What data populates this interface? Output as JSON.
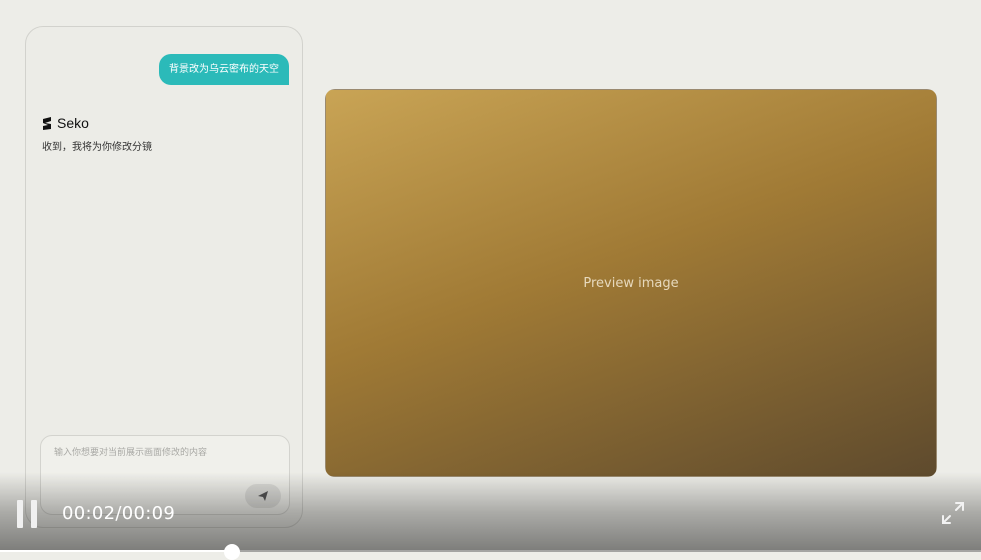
{
  "chat": {
    "user_message": "背景改为乌云密布的天空",
    "assistant_name": "Seko",
    "assistant_message": "收到，我将为你修改分镜",
    "input_placeholder": "输入你想要对当前展示画面修改的内容"
  },
  "preview": {
    "image_label": "Preview image"
  },
  "player": {
    "time": "00:02/00:09",
    "progress": 0.2222
  },
  "colors": {
    "accent": "#2bbab9"
  }
}
